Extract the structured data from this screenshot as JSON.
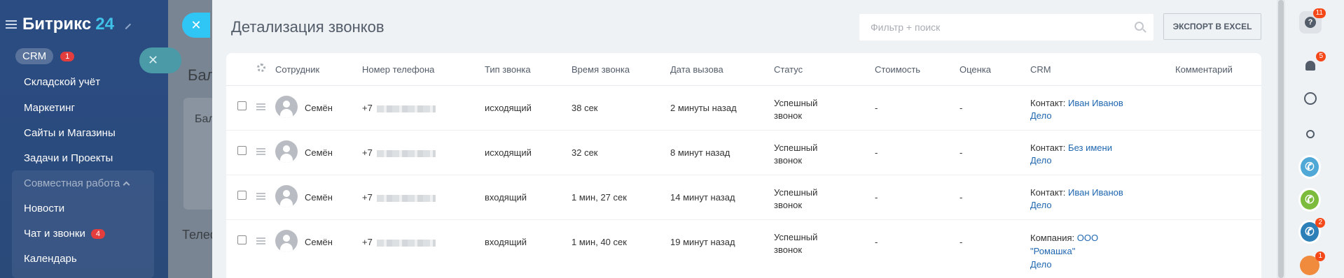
{
  "sidebar": {
    "brand_name": "Битрикс",
    "brand_num": "24",
    "crm_label": "CRM",
    "crm_badge": "1",
    "items": [
      {
        "label": "Складской учёт"
      },
      {
        "label": "Маркетинг"
      },
      {
        "label": "Сайты и Магазины"
      },
      {
        "label": "Задачи и Проекты"
      }
    ],
    "group_title": "Совместная работа",
    "group_items": [
      {
        "label": "Новости"
      },
      {
        "label": "Чат и звонки",
        "badge": "4"
      },
      {
        "label": "Календарь"
      }
    ]
  },
  "background": {
    "text1": "Бал",
    "text2": "Бал",
    "text3": "Телеф"
  },
  "panel": {
    "title": "Детализация звонков",
    "search_placeholder": "Фильтр + поиск",
    "export_label": "ЭКСПОРТ В EXCEL",
    "columns": [
      "Сотрудник",
      "Номер телефона",
      "Тип звонка",
      "Время звонка",
      "Дата вызова",
      "Статус",
      "Стоимость",
      "Оценка",
      "CRM",
      "Комментарий"
    ],
    "rows": [
      {
        "employee": "Семён",
        "phone": "+7",
        "type": "исходящий",
        "duration": "38 сек",
        "date": "2 минуты назад",
        "status_1": "Успешный",
        "status_2": "звонок",
        "cost": "-",
        "rating": "-",
        "crm_prefix": "Контакт:",
        "crm_link": "Иван Иванов",
        "crm_link2": "",
        "crm_deal": "Дело"
      },
      {
        "employee": "Семён",
        "phone": "+7",
        "type": "исходящий",
        "duration": "32 сек",
        "date": "8 минут назад",
        "status_1": "Успешный",
        "status_2": "звонок",
        "cost": "-",
        "rating": "-",
        "crm_prefix": "Контакт:",
        "crm_link": "Без имени",
        "crm_link2": "",
        "crm_deal": "Дело"
      },
      {
        "employee": "Семён",
        "phone": "+7",
        "type": "входящий",
        "duration": "1 мин, 27 сек",
        "date": "14 минут назад",
        "status_1": "Успешный",
        "status_2": "звонок",
        "cost": "-",
        "rating": "-",
        "crm_prefix": "Контакт:",
        "crm_link": "Иван Иванов",
        "crm_link2": "",
        "crm_deal": "Дело"
      },
      {
        "employee": "Семён",
        "phone": "+7",
        "type": "входящий",
        "duration": "1 мин, 40 сек",
        "date": "19 минут назад",
        "status_1": "Успешный",
        "status_2": "звонок",
        "cost": "-",
        "rating": "-",
        "crm_prefix": "Компания:",
        "crm_link": "ООО",
        "crm_link2": "\"Ромашка\"",
        "crm_deal": "Дело"
      }
    ]
  },
  "right_panel": {
    "help_badge": "11",
    "bell_badge": "5",
    "phone3_badge": "2",
    "avatar_badge": "1"
  },
  "colors": {
    "accent": "#2fc6f6",
    "link": "#2067b0",
    "badge": "#e33d3d"
  }
}
